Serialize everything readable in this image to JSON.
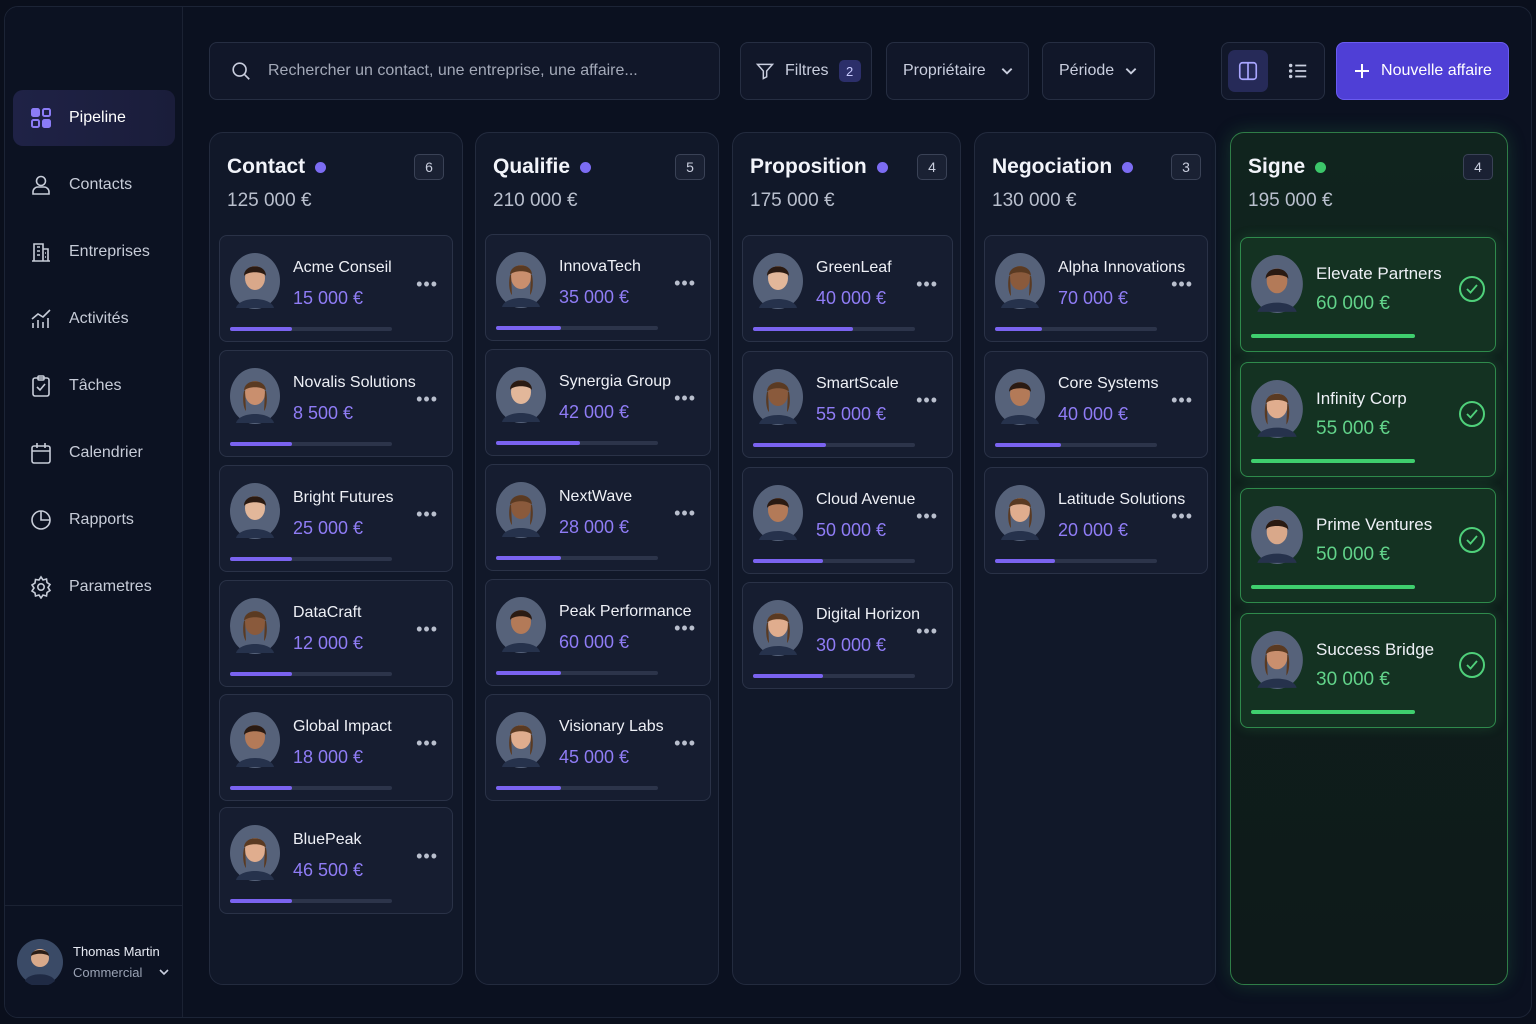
{
  "sidebar": {
    "items": [
      {
        "label": "Pipeline",
        "icon": "grid-icon",
        "active": true
      },
      {
        "label": "Contacts",
        "icon": "person-icon"
      },
      {
        "label": "Entreprises",
        "icon": "building-icon"
      },
      {
        "label": "Activités",
        "icon": "chart-line-icon"
      },
      {
        "label": "Tâches",
        "icon": "clipboard-check-icon"
      },
      {
        "label": "Calendrier",
        "icon": "calendar-icon"
      },
      {
        "label": "Rapports",
        "icon": "pie-chart-icon"
      },
      {
        "label": "Parametres",
        "icon": "gear-icon"
      }
    ],
    "user": {
      "name": "Thomas Martin",
      "role": "Commercial"
    }
  },
  "toolbar": {
    "search_placeholder": "Rechercher un contact, une entreprise, une affaire...",
    "filters_label": "Filtres",
    "filters_count": "2",
    "owner_label": "Propriétaire",
    "period_label": "Période",
    "new_deal_label": "Nouvelle affaire"
  },
  "colors": {
    "accent": "#4f3fd6",
    "value": "#8f7cf5",
    "won": "#3fcf6e"
  },
  "columns": [
    {
      "title": "Contact",
      "count": "6",
      "total": "125 000 €",
      "cards": [
        {
          "name": "Acme Conseil",
          "value": "15 000 €",
          "progress": 0.38
        },
        {
          "name": "Novalis Solutions",
          "value": "8 500 €",
          "progress": 0.38
        },
        {
          "name": "Bright Futures",
          "value": "25 000 €",
          "progress": 0.38
        },
        {
          "name": "DataCraft",
          "value": "12 000 €",
          "progress": 0.38
        },
        {
          "name": "Global Impact",
          "value": "18 000 €",
          "progress": 0.38
        },
        {
          "name": "BluePeak",
          "value": "46 500 €",
          "progress": 0.38
        }
      ]
    },
    {
      "title": "Qualifie",
      "count": "5",
      "total": "210 000 €",
      "cards": [
        {
          "name": "InnovaTech",
          "value": "35 000 €",
          "progress": 0.4
        },
        {
          "name": "Synergia Group",
          "value": "42 000 €",
          "progress": 0.52
        },
        {
          "name": "NextWave",
          "value": "28 000 €",
          "progress": 0.4
        },
        {
          "name": "Peak Performance",
          "value": "60 000 €",
          "progress": 0.4
        },
        {
          "name": "Visionary Labs",
          "value": "45 000 €",
          "progress": 0.4
        }
      ]
    },
    {
      "title": "Proposition",
      "count": "4",
      "total": "175 000 €",
      "cards": [
        {
          "name": "GreenLeaf",
          "value": "40 000 €",
          "progress": 0.62
        },
        {
          "name": "SmartScale",
          "value": "55 000 €",
          "progress": 0.45
        },
        {
          "name": "Cloud Avenue",
          "value": "50 000 €",
          "progress": 0.43
        },
        {
          "name": "Digital Horizon",
          "value": "30 000 €",
          "progress": 0.43
        }
      ]
    },
    {
      "title": "Negociation",
      "count": "3",
      "total": "130 000 €",
      "cards": [
        {
          "name": "Alpha Innovations",
          "value": "70 000 €",
          "progress": 0.29
        },
        {
          "name": "Core Systems",
          "value": "40 000 €",
          "progress": 0.41
        },
        {
          "name": "Latitude Solutions",
          "value": "20 000 €",
          "progress": 0.37
        }
      ]
    },
    {
      "title": "Signe",
      "count": "4",
      "total": "195 000 €",
      "won": true,
      "cards": [
        {
          "name": "Elevate Partners",
          "value": "60 000 €",
          "progress": 1
        },
        {
          "name": "Infinity Corp",
          "value": "55 000 €",
          "progress": 1
        },
        {
          "name": "Prime Ventures",
          "value": "50 000 €",
          "progress": 1
        },
        {
          "name": "Success Bridge",
          "value": "30 000 €",
          "progress": 1
        }
      ]
    }
  ]
}
